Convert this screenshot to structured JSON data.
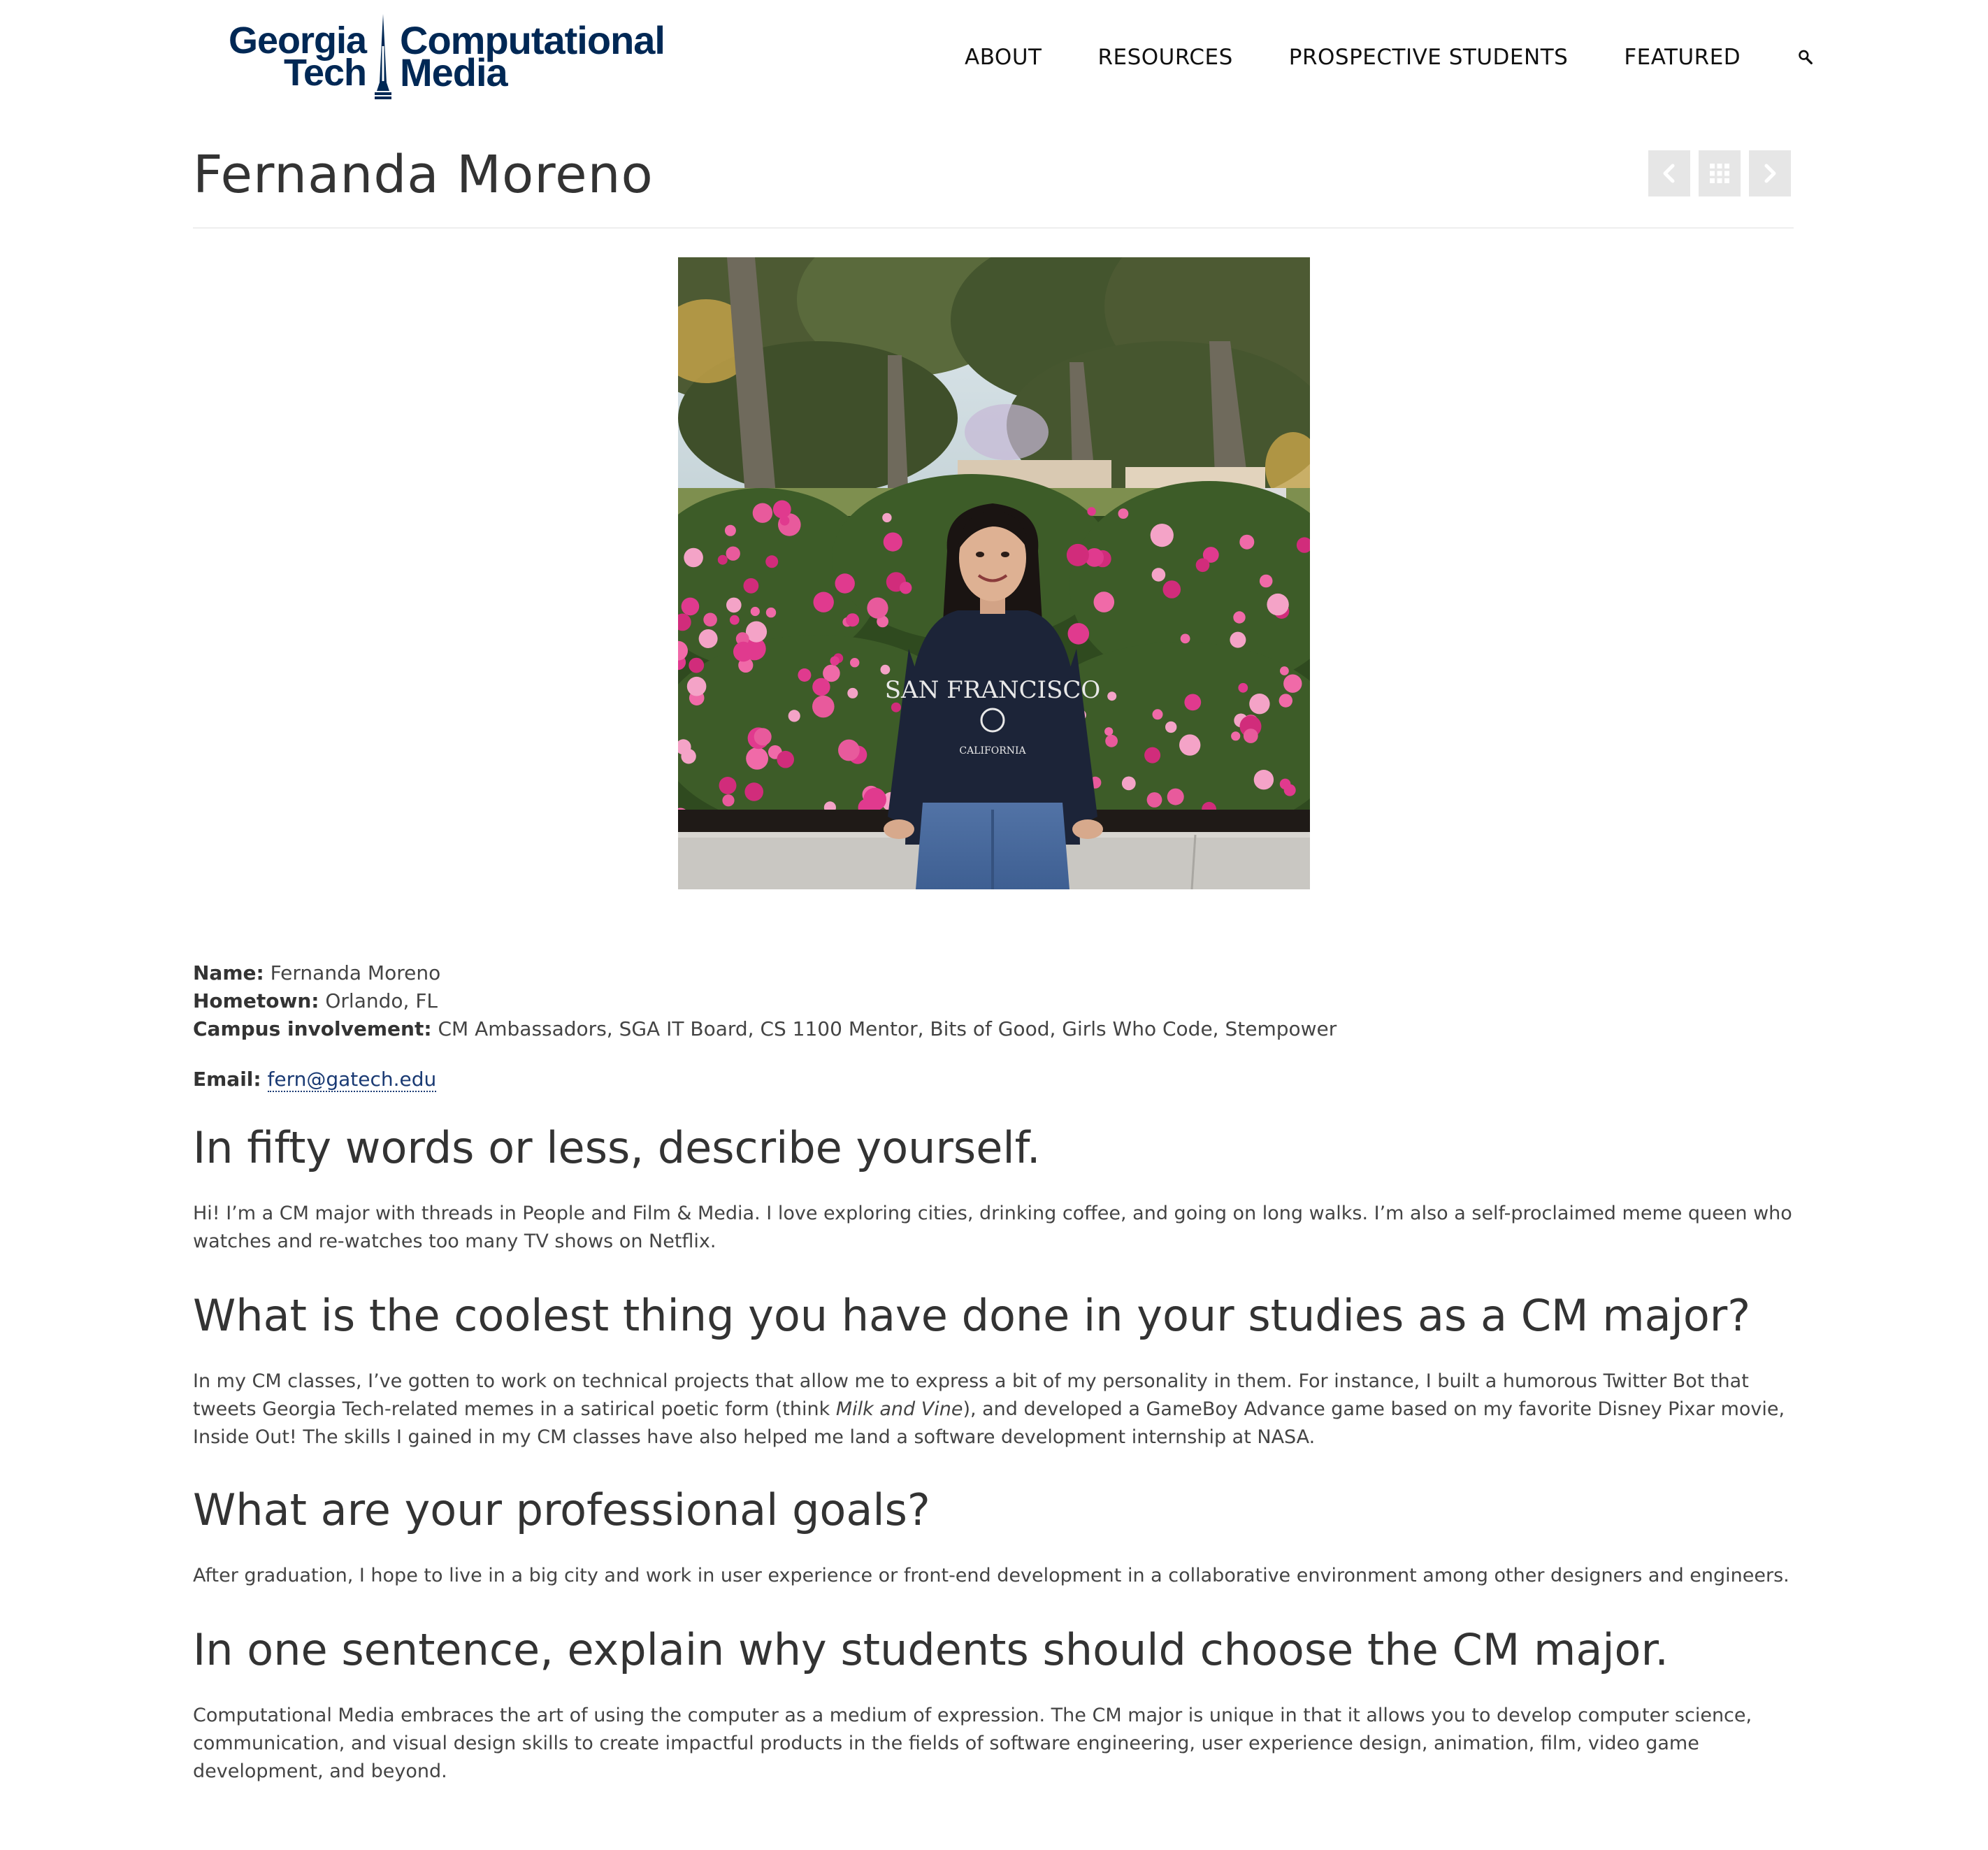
{
  "header": {
    "logo": {
      "left_line1": "Georgia",
      "left_line2": "Tech",
      "right_line1": "Computational",
      "right_line2": "Media"
    },
    "nav": [
      "ABOUT",
      "RESOURCES",
      "PROSPECTIVE STUDENTS",
      "FEATURED"
    ],
    "search_icon": "search-icon"
  },
  "page": {
    "title": "Fernanda Moreno",
    "post_nav": {
      "prev_icon": "chevron-left-icon",
      "grid_icon": "grid-icon",
      "next_icon": "chevron-right-icon"
    }
  },
  "profile": {
    "name_label": "Name:",
    "name_value": "Fernanda Moreno",
    "hometown_label": "Hometown:",
    "hometown_value": "Orlando, FL",
    "involvement_label": "Campus involvement:",
    "involvement_value": "CM Ambassadors, SGA IT Board, CS 1100 Mentor, Bits of Good, Girls Who Code, Stempower",
    "email_label": "Email:",
    "email_value": "fern@gatech.edu",
    "photo_sweatshirt_text": "SAN FRANCISCO CALIFORNIA"
  },
  "qa": [
    {
      "question": "In fifty words or less, describe yourself.",
      "answer": "Hi! I’m a CM major with threads in People and Film & Media. I love exploring cities, drinking coffee, and going on long walks. I’m also a self-proclaimed meme queen who watches and re-watches too many TV shows on Netflix."
    },
    {
      "question": "What is the coolest thing you have done in your studies as a CM major?",
      "answer_before": "In my CM classes, I’ve gotten to work on technical projects that allow me to express a bit of my personality in them. For instance, I built a humorous Twitter Bot that tweets Georgia Tech-related memes in a satirical poetic form (think ",
      "answer_italic": "Milk and Vine",
      "answer_after": "), and developed a GameBoy Advance game based on my favorite Disney Pixar movie, Inside Out! The skills I gained in my CM classes have also helped me land a software development internship at NASA."
    },
    {
      "question": "What are your professional goals?",
      "answer": "After graduation, I hope to live in a big city and work in user experience or front-end development in a collaborative environment among other designers and engineers."
    },
    {
      "question": "In one sentence, explain why students should choose the CM major.",
      "answer": "Computational Media embraces the art of using the computer as a medium of expression. The CM major is unique in that it allows you to develop computer science, communication, and visual design skills to create impactful products in the fields of software engineering, user experience design, animation, film, video game development, and beyond."
    }
  ],
  "colors": {
    "brand_navy": "#002855",
    "link": "#1a3a73",
    "text": "#333333",
    "button_bg": "#e6e6e6"
  }
}
